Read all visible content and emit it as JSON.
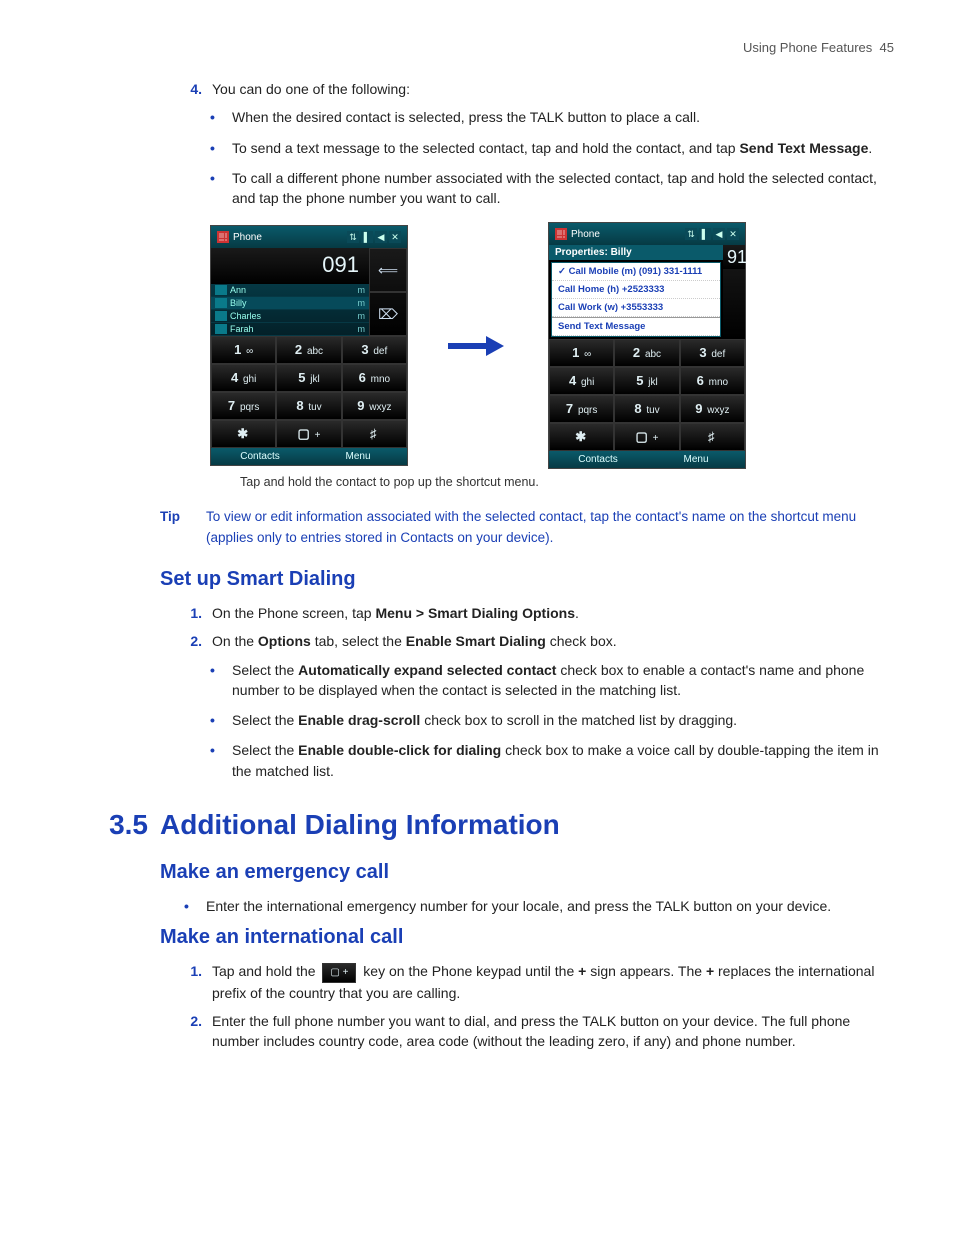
{
  "header": {
    "section": "Using Phone Features",
    "page": "45"
  },
  "top_list": {
    "num": "4.",
    "lead": "You can do one of the following:",
    "items": [
      {
        "text": "When the desired contact is selected, press the TALK button to place a call."
      },
      {
        "pre": "To send a text message to the selected contact, tap and hold the contact, and tap ",
        "bold": "Send Text Message",
        "post": "."
      },
      {
        "text": "To call a different phone number associated with the selected contact, tap and hold the selected contact, and tap the phone number you want to call."
      }
    ]
  },
  "phone_left": {
    "title": "Phone",
    "display": "091",
    "contacts": [
      {
        "name": "Ann",
        "suf": "m"
      },
      {
        "name": "Billy",
        "suf": "m"
      },
      {
        "name": "Charles",
        "suf": "m"
      },
      {
        "name": "Farah",
        "suf": "m"
      }
    ],
    "side": {
      "back": "⟸",
      "del": "⌦"
    },
    "soft": {
      "left": "Contacts",
      "right": "Menu"
    }
  },
  "phone_right": {
    "title": "Phone",
    "popup_title": "Properties: Billy",
    "display": "91",
    "menu": [
      "Call Mobile (m) (091) 331-1111",
      "Call Home (h) +2523333",
      "Call Work (w) +3553333",
      "Send Text Message"
    ],
    "soft": {
      "left": "Contacts",
      "right": "Menu"
    }
  },
  "keypad": [
    {
      "n": "1",
      "l": "∞"
    },
    {
      "n": "2",
      "l": "abc"
    },
    {
      "n": "3",
      "l": "def"
    },
    {
      "n": "4",
      "l": "ghi"
    },
    {
      "n": "5",
      "l": "jkl"
    },
    {
      "n": "6",
      "l": "mno"
    },
    {
      "n": "7",
      "l": "pqrs"
    },
    {
      "n": "8",
      "l": "tuv"
    },
    {
      "n": "9",
      "l": "wxyz"
    },
    {
      "n": "✱",
      "l": ""
    },
    {
      "n": "▢",
      "l": "+"
    },
    {
      "n": "♯",
      "l": ""
    }
  ],
  "caption": "Tap and hold the contact to pop up the shortcut menu.",
  "tip": {
    "label": "Tip",
    "text": "To view or edit information associated with the selected contact, tap the contact's name on the shortcut menu (applies only to entries stored in Contacts on your device)."
  },
  "smart": {
    "title": "Set up Smart Dialing",
    "steps": [
      {
        "num": "1.",
        "pre": "On the Phone screen, tap ",
        "bold": "Menu > Smart Dialing Options",
        "post": "."
      },
      {
        "num": "2.",
        "pre": "On the ",
        "bold": "Options",
        "mid": " tab, select the ",
        "bold2": "Enable Smart Dialing",
        "post": " check box."
      }
    ],
    "bullets": [
      {
        "pre": "Select the ",
        "bold": "Automatically expand selected contact",
        "post": " check box to enable a contact's name and phone number to be displayed when the contact is selected in the matching list."
      },
      {
        "pre": "Select the ",
        "bold": "Enable drag-scroll",
        "post": " check box to scroll in the matched list by dragging."
      },
      {
        "pre": "Select the ",
        "bold": "Enable double-click for dialing",
        "post": " check box to make a voice call by double-tapping the item in the matched list."
      }
    ]
  },
  "section35": {
    "num": "3.5",
    "title": "Additional Dialing Information",
    "emergency": {
      "title": "Make an emergency call",
      "item": "Enter the international emergency number for your locale, and press the TALK button on your device."
    },
    "intl": {
      "title": "Make an international call",
      "step1": {
        "num": "1.",
        "pre": "Tap and hold the ",
        "key": "▢ +",
        "mid": " key on the Phone keypad until the ",
        "b1": "+",
        "mid2": " sign appears. The ",
        "b2": "+",
        "post": " replaces the international prefix of the country that you are calling."
      },
      "step2": {
        "num": "2.",
        "text": "Enter the full phone number you want to dial, and press the TALK button on your device. The full phone number includes country code, area code (without the leading zero, if any) and phone number."
      }
    }
  }
}
